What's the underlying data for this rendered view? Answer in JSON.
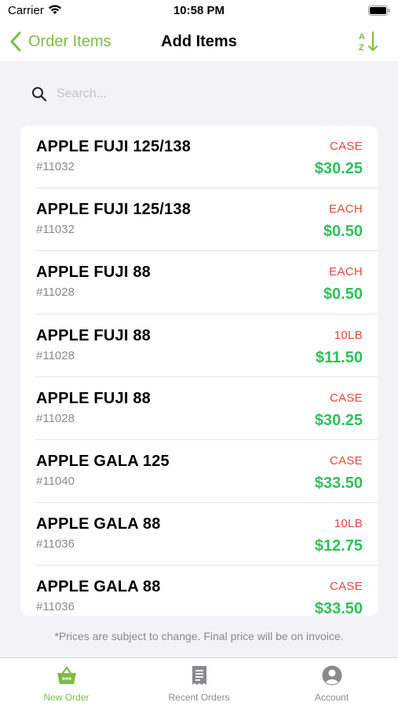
{
  "status_bar": {
    "carrier": "Carrier",
    "time": "10:58 PM"
  },
  "nav": {
    "back_label": "Order Items",
    "title": "Add Items",
    "sort_icon": "sort-a-z-icon"
  },
  "search": {
    "placeholder": "Search...",
    "value": ""
  },
  "items": [
    {
      "name": "APPLE FUJI 125/138",
      "sku": "#11032",
      "unit": "CASE",
      "price": "$30.25"
    },
    {
      "name": "APPLE FUJI 125/138",
      "sku": "#11032",
      "unit": "EACH",
      "price": "$0.50"
    },
    {
      "name": "APPLE FUJI 88",
      "sku": "#11028",
      "unit": "EACH",
      "price": "$0.50"
    },
    {
      "name": "APPLE FUJI 88",
      "sku": "#11028",
      "unit": "10LB",
      "price": "$11.50"
    },
    {
      "name": "APPLE FUJI 88",
      "sku": "#11028",
      "unit": "CASE",
      "price": "$30.25"
    },
    {
      "name": "APPLE GALA 125",
      "sku": "#11040",
      "unit": "CASE",
      "price": "$33.50"
    },
    {
      "name": "APPLE GALA 88",
      "sku": "#11036",
      "unit": "10LB",
      "price": "$12.75"
    },
    {
      "name": "APPLE GALA 88",
      "sku": "#11036",
      "unit": "CASE",
      "price": "$33.50"
    }
  ],
  "disclaimer": "*Prices are subject to change. Final price will be on invoice.",
  "tabs": [
    {
      "label": "New Order",
      "icon": "basket-icon",
      "active": true
    },
    {
      "label": "Recent Orders",
      "icon": "receipt-icon",
      "active": false
    },
    {
      "label": "Account",
      "icon": "account-icon",
      "active": false
    }
  ],
  "colors": {
    "accent": "#7dbd44",
    "price": "#2ec15a",
    "unit": "#e8453c"
  }
}
